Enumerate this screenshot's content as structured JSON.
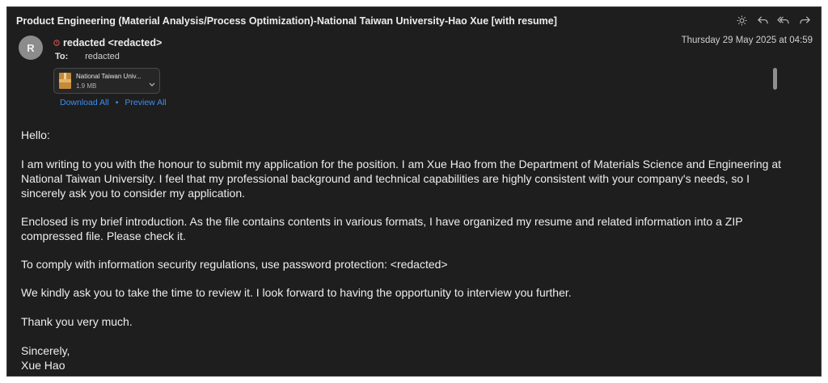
{
  "email": {
    "subject": "Product Engineering (Material Analysis/Process Optimization)-National Taiwan University-Hao Xue [with resume]",
    "sender_initial": "R",
    "from": "redacted <redacted>",
    "date": "Thursday 29 May 2025 at 04:59",
    "to_label": "To:",
    "to": "redacted",
    "attachment": {
      "name": "National Taiwan Univ...",
      "size": "1.9 MB",
      "icon": "archive-file-icon"
    },
    "download_all": "Download All",
    "separator": "•",
    "preview_all": "Preview All"
  },
  "toolbar": {
    "icons": [
      "sun-icon",
      "reply-icon",
      "reply-all-icon",
      "forward-icon"
    ]
  },
  "body": {
    "greeting": "Hello:",
    "p1": "I am writing to you with the honour to submit my application for the position. I am Xue Hao from the Department of Materials Science and Engineering at National Taiwan University. I feel that my professional background and technical capabilities are highly consistent with your company's needs, so I sincerely ask you to consider my application.",
    "p2": "Enclosed is my brief introduction. As the file contains contents in various formats, I have organized my resume and related information into a ZIP compressed file. Please check it.",
    "p3": "To comply with information security regulations, use password protection: <redacted>",
    "p4": "We kindly ask you to take the time to review it. I look forward to having the opportunity to interview you further.",
    "p5": "Thank you very much.",
    "closing": "Sincerely,",
    "signature": "Xue Hao"
  },
  "colors": {
    "background": "#1e1e1e",
    "link": "#3d8ef0",
    "flag": "#d9534f",
    "avatar": "#8c8c8c"
  }
}
